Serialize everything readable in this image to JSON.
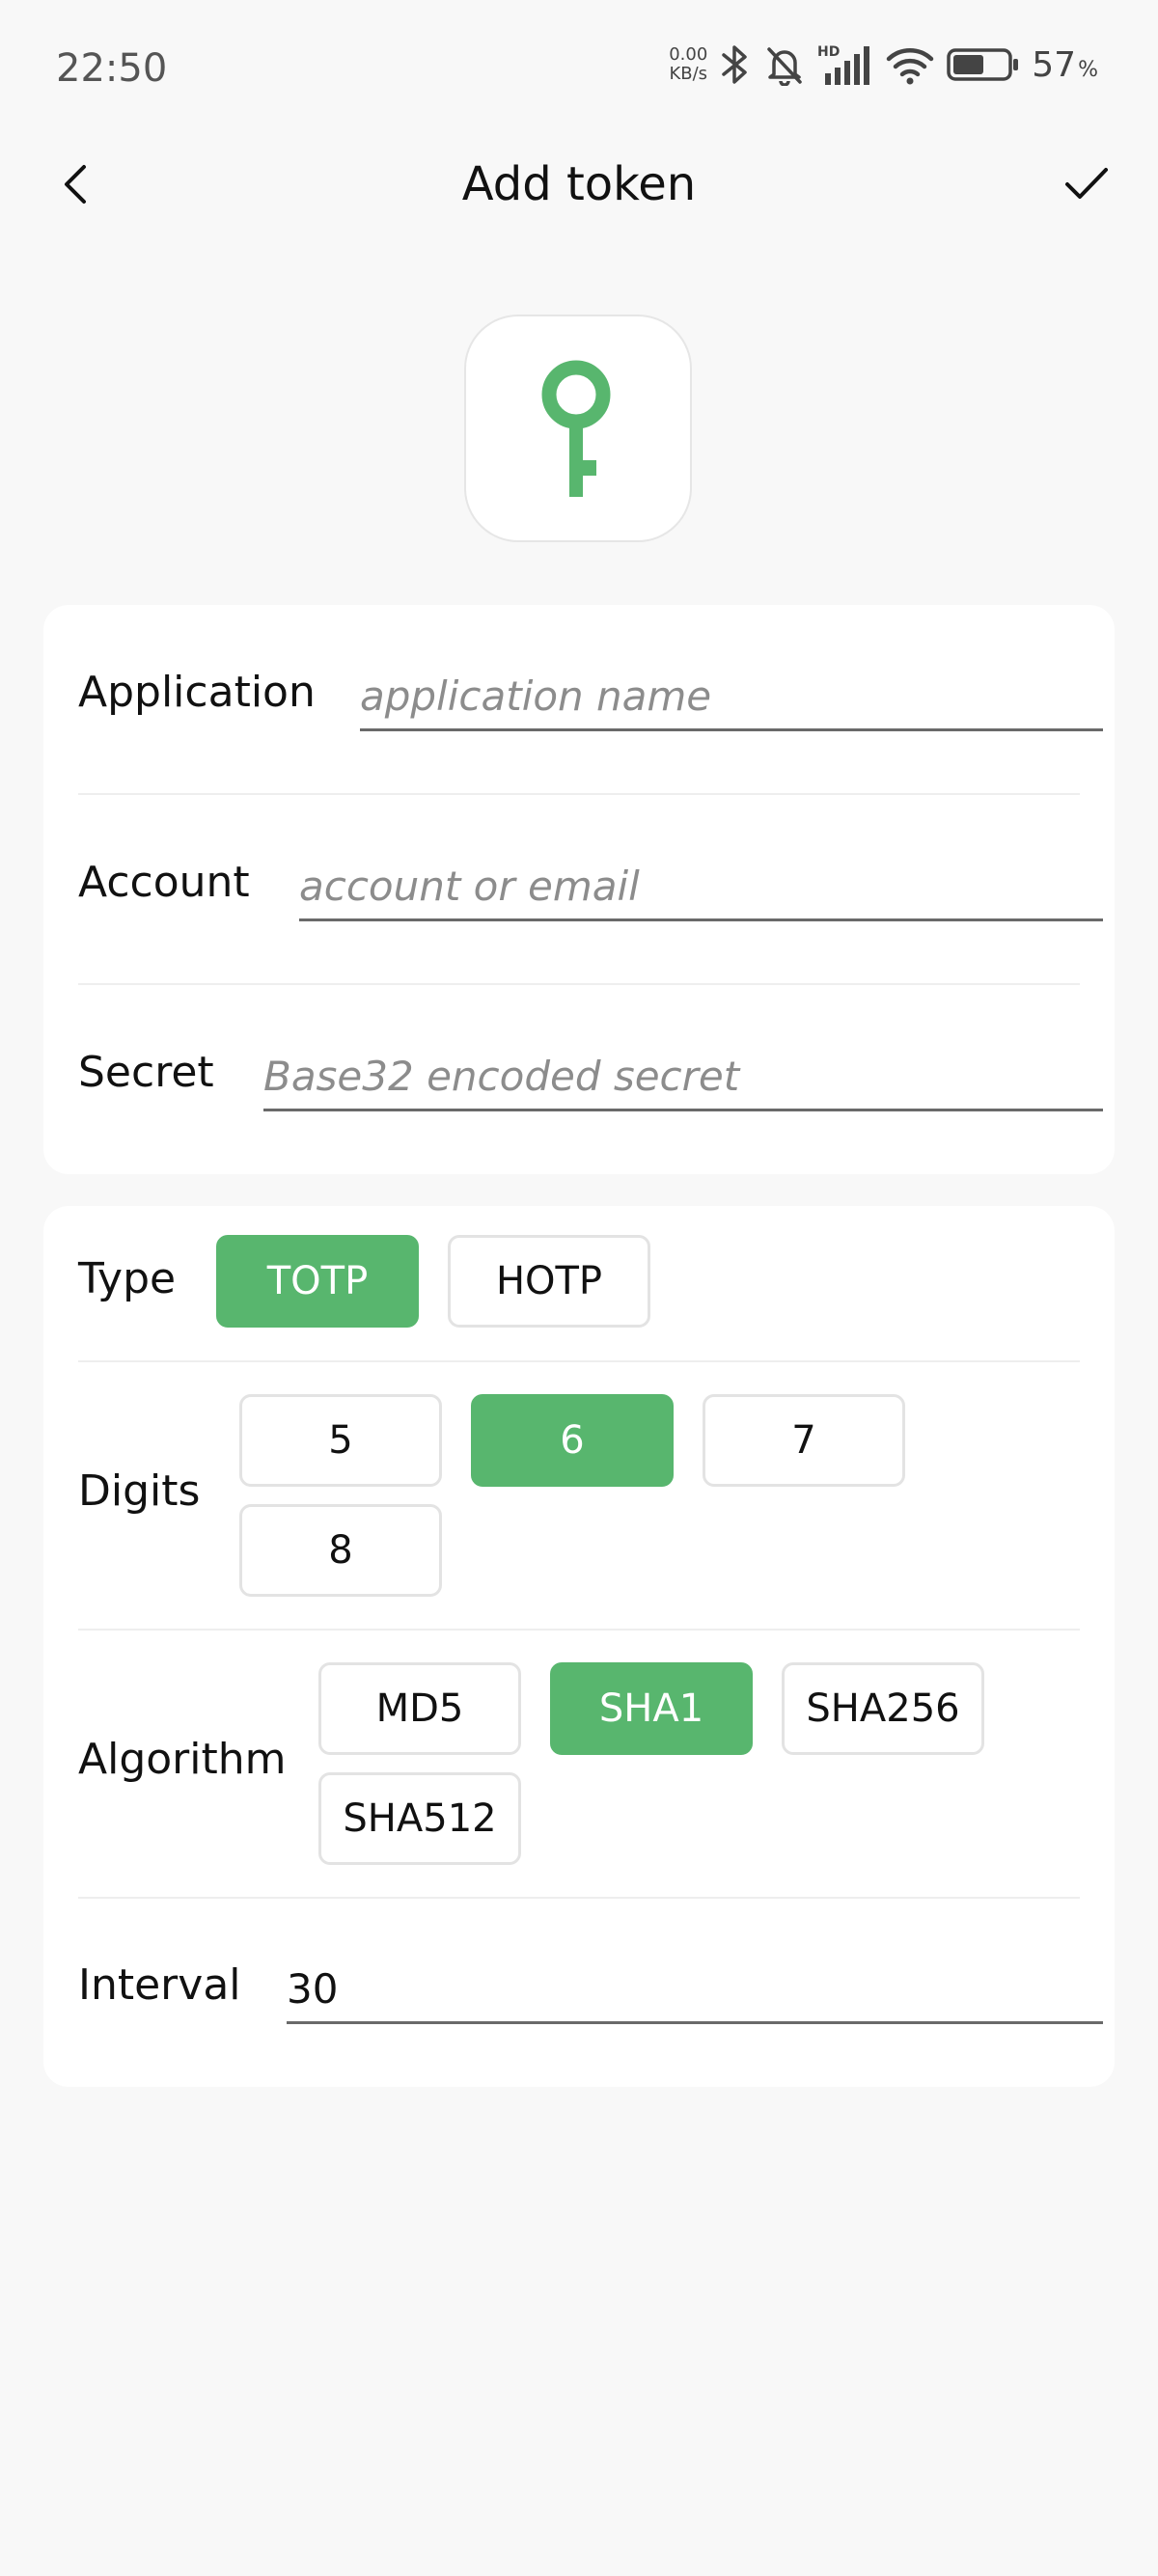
{
  "status_bar": {
    "time": "22:50",
    "net_speed_value": "0.00",
    "net_speed_unit": "KB/s",
    "battery_percent": "57",
    "battery_percent_sign": "%",
    "battery_level": 0.57,
    "network_badge": "HD"
  },
  "header": {
    "title": "Add token"
  },
  "colors": {
    "accent": "#58b66e",
    "background": "#f8f8f8",
    "card": "#ffffff"
  },
  "app_icon": {
    "icon": "key-icon"
  },
  "form": {
    "application": {
      "label": "Application",
      "placeholder": "application name",
      "value": ""
    },
    "account": {
      "label": "Account",
      "placeholder": "account or email",
      "value": ""
    },
    "secret": {
      "label": "Secret",
      "placeholder": "Base32 encoded secret",
      "value": ""
    }
  },
  "options": {
    "type": {
      "label": "Type",
      "choices": [
        "TOTP",
        "HOTP"
      ],
      "selected": "TOTP"
    },
    "digits": {
      "label": "Digits",
      "choices": [
        "5",
        "6",
        "7",
        "8"
      ],
      "selected": "6"
    },
    "algorithm": {
      "label": "Algorithm",
      "choices": [
        "MD5",
        "SHA1",
        "SHA256",
        "SHA512"
      ],
      "selected": "SHA1"
    },
    "interval": {
      "label": "Interval",
      "value": "30"
    }
  }
}
